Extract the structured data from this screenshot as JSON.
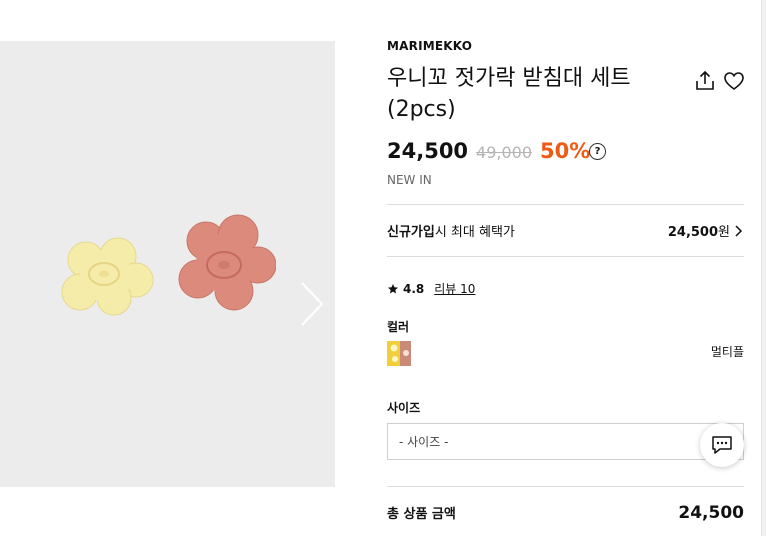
{
  "product": {
    "brand": "MARIMEKKO",
    "title": "우니꼬 젓가락 받침대 세트 (2pcs)",
    "price": "24,500",
    "original_price": "49,000",
    "discount": "50%",
    "help_glyph": "?",
    "badge": "NEW IN"
  },
  "benefit": {
    "label_bold": "신규가입",
    "label_rest": "시 최대 혜택가",
    "amount": "24,500",
    "currency": "원"
  },
  "rating": {
    "score": "4.8",
    "reviews": "리뷰 10"
  },
  "color": {
    "label": "컬러",
    "selected_name": "멀티플"
  },
  "size": {
    "label": "사이즈",
    "selected": "- 사이즈 -"
  },
  "total": {
    "label": "총 상품 금액",
    "value": "24,500"
  },
  "icons": {
    "share": "share-icon",
    "wishlist": "heart-icon",
    "next": "chevron-right-icon",
    "chat": "chat-icon",
    "star": "star-icon"
  },
  "colors": {
    "discount": "#f05a14",
    "gallery_bg": "#ececec",
    "flower_yellow": "#f6ecaa",
    "flower_pink": "#dc8a7c"
  }
}
